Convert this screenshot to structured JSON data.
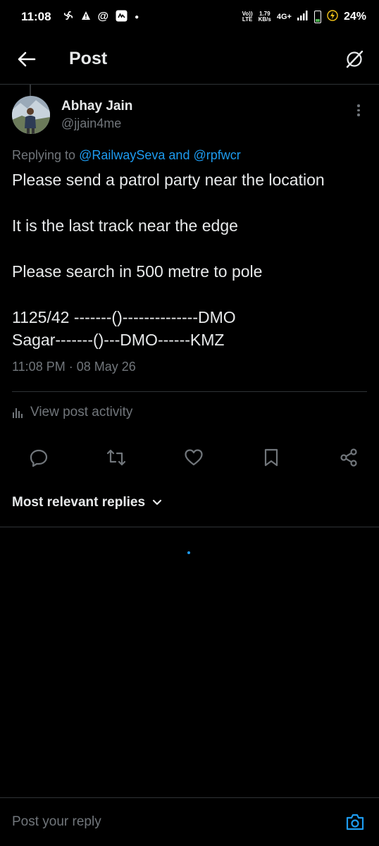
{
  "status_bar": {
    "time": "11:08",
    "network_volte": "Vo))",
    "network_lte": "LTE",
    "speed_value": "1.79",
    "speed_unit": "KB/s",
    "network_type": "4G+",
    "battery_percent": "24%"
  },
  "header": {
    "title": "Post"
  },
  "post": {
    "author_name": "Abhay Jain",
    "author_handle": "@jjain4me",
    "replying_prefix": "Replying to",
    "replying_mention1": "@RailwaySeva",
    "replying_and": "and",
    "replying_mention2": "@rpfwcr",
    "text_lines": [
      "Please send a patrol party near the location",
      "It is the last track near the edge",
      "Please search in 500 metre to pole",
      "1125/42 -------()--------------DMO",
      "Sagar-------()---DMO------KMZ"
    ],
    "timestamp": "11:08 PM · 08 May 26"
  },
  "activity": {
    "label": "View post activity"
  },
  "actions": {
    "icons": [
      "reply-icon",
      "repost-icon",
      "like-icon",
      "bookmark-icon",
      "share-icon"
    ]
  },
  "replies": {
    "sort_label": "Most relevant replies"
  },
  "reply_bar": {
    "placeholder": "Post your reply"
  },
  "colors": {
    "background": "#000000",
    "text": "#e7e9ea",
    "muted": "#71767b",
    "accent": "#1d9bf0",
    "divider": "#2f3336"
  }
}
